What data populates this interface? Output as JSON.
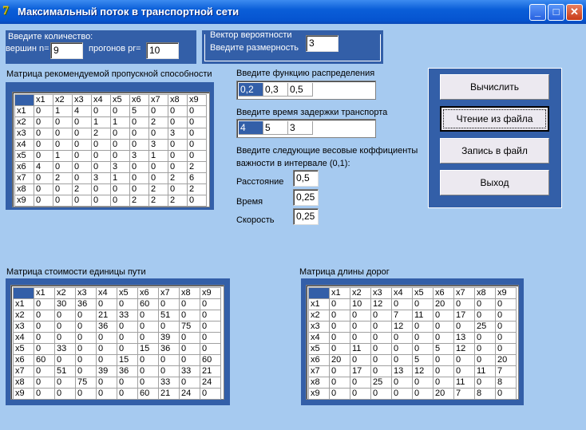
{
  "window": {
    "title": "Максимальный поток в транспортной сети",
    "icon": "delphi-app-icon"
  },
  "count_group": {
    "title": "Введите количество:",
    "vertices_label": "вершин n=",
    "vertices_value": "9",
    "runs_label": "прогонов pr=",
    "runs_value": "10"
  },
  "prob_group": {
    "title": "Вектор вероятности",
    "dim_label": "Введите размерность",
    "dim_value": "3"
  },
  "distribution": {
    "label": "Введите функцию распределения",
    "values": [
      "0,2",
      "0,3",
      "0,5"
    ]
  },
  "delay": {
    "label": "Введите время задержки транспорта",
    "values": [
      "4",
      "5",
      "3"
    ]
  },
  "weights": {
    "label1": "Введите следующие весовые коффициенты",
    "label2": "важности в интервале (0,1):",
    "distance_label": "Расстояние",
    "distance": "0,5",
    "time_label": "Время",
    "time": "0,25",
    "speed_label": "Скорость",
    "speed": "0,25"
  },
  "buttons": {
    "compute": "Вычислить",
    "read": "Чтение из файла",
    "write": "Запись в файл",
    "exit": "Выход"
  },
  "headers": [
    "x1",
    "x2",
    "x3",
    "x4",
    "x5",
    "x6",
    "x7",
    "x8",
    "x9"
  ],
  "capacity": {
    "title": "Матрица рекомендуемой пропускной способности",
    "rows": [
      [
        "0",
        "1",
        "4",
        "0",
        "0",
        "5",
        "0",
        "0",
        "0"
      ],
      [
        "0",
        "0",
        "0",
        "1",
        "1",
        "0",
        "2",
        "0",
        "0"
      ],
      [
        "0",
        "0",
        "0",
        "2",
        "0",
        "0",
        "0",
        "3",
        "0"
      ],
      [
        "0",
        "0",
        "0",
        "0",
        "0",
        "0",
        "3",
        "0",
        "0"
      ],
      [
        "0",
        "1",
        "0",
        "0",
        "0",
        "3",
        "1",
        "0",
        "0"
      ],
      [
        "4",
        "0",
        "0",
        "0",
        "3",
        "0",
        "0",
        "0",
        "2"
      ],
      [
        "0",
        "2",
        "0",
        "3",
        "1",
        "0",
        "0",
        "2",
        "6"
      ],
      [
        "0",
        "0",
        "2",
        "0",
        "0",
        "0",
        "2",
        "0",
        "2"
      ],
      [
        "0",
        "0",
        "0",
        "0",
        "0",
        "2",
        "2",
        "2",
        "0"
      ]
    ]
  },
  "cost": {
    "title": "Матрица стоимости единицы пути",
    "rows": [
      [
        "0",
        "30",
        "36",
        "0",
        "0",
        "60",
        "0",
        "0",
        "0"
      ],
      [
        "0",
        "0",
        "0",
        "21",
        "33",
        "0",
        "51",
        "0",
        "0"
      ],
      [
        "0",
        "0",
        "0",
        "36",
        "0",
        "0",
        "0",
        "75",
        "0"
      ],
      [
        "0",
        "0",
        "0",
        "0",
        "0",
        "0",
        "39",
        "0",
        "0"
      ],
      [
        "0",
        "33",
        "0",
        "0",
        "0",
        "15",
        "36",
        "0",
        "0"
      ],
      [
        "60",
        "0",
        "0",
        "0",
        "15",
        "0",
        "0",
        "0",
        "60"
      ],
      [
        "0",
        "51",
        "0",
        "39",
        "36",
        "0",
        "0",
        "33",
        "21"
      ],
      [
        "0",
        "0",
        "75",
        "0",
        "0",
        "0",
        "33",
        "0",
        "24"
      ],
      [
        "0",
        "0",
        "0",
        "0",
        "0",
        "60",
        "21",
        "24",
        "0"
      ]
    ]
  },
  "length": {
    "title": "Матрица длины дорог",
    "rows": [
      [
        "0",
        "10",
        "12",
        "0",
        "0",
        "20",
        "0",
        "0",
        "0"
      ],
      [
        "0",
        "0",
        "0",
        "7",
        "11",
        "0",
        "17",
        "0",
        "0"
      ],
      [
        "0",
        "0",
        "0",
        "12",
        "0",
        "0",
        "0",
        "25",
        "0"
      ],
      [
        "0",
        "0",
        "0",
        "0",
        "0",
        "0",
        "13",
        "0",
        "0"
      ],
      [
        "0",
        "11",
        "0",
        "0",
        "0",
        "5",
        "12",
        "0",
        "0"
      ],
      [
        "20",
        "0",
        "0",
        "0",
        "5",
        "0",
        "0",
        "0",
        "20"
      ],
      [
        "0",
        "17",
        "0",
        "13",
        "12",
        "0",
        "0",
        "11",
        "7"
      ],
      [
        "0",
        "0",
        "25",
        "0",
        "0",
        "0",
        "11",
        "0",
        "8"
      ],
      [
        "0",
        "0",
        "0",
        "0",
        "0",
        "20",
        "7",
        "8",
        "0"
      ]
    ]
  }
}
